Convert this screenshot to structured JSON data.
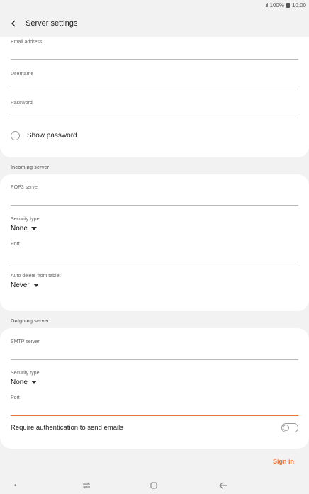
{
  "status": {
    "signal": ".ıl",
    "battery_text": "100%",
    "time": "10:00"
  },
  "header": {
    "title": "Server settings"
  },
  "account": {
    "email_label": "Email address",
    "username_label": "Username",
    "password_label": "Password",
    "show_password": "Show password"
  },
  "incoming": {
    "section": "Incoming server",
    "server_label": "POP3 server",
    "security_label": "Security type",
    "security_value": "None",
    "port_label": "Port",
    "auto_delete_label": "Auto delete from tablet",
    "auto_delete_value": "Never"
  },
  "outgoing": {
    "section": "Outgoing server",
    "server_label": "SMTP server",
    "security_label": "Security type",
    "security_value": "None",
    "port_label": "Port",
    "require_auth": "Require authentication to send emails"
  },
  "actions": {
    "sign_in": "Sign in"
  },
  "colors": {
    "accent": "#e8743b",
    "background": "#f2f2f2",
    "card": "#ffffff"
  }
}
